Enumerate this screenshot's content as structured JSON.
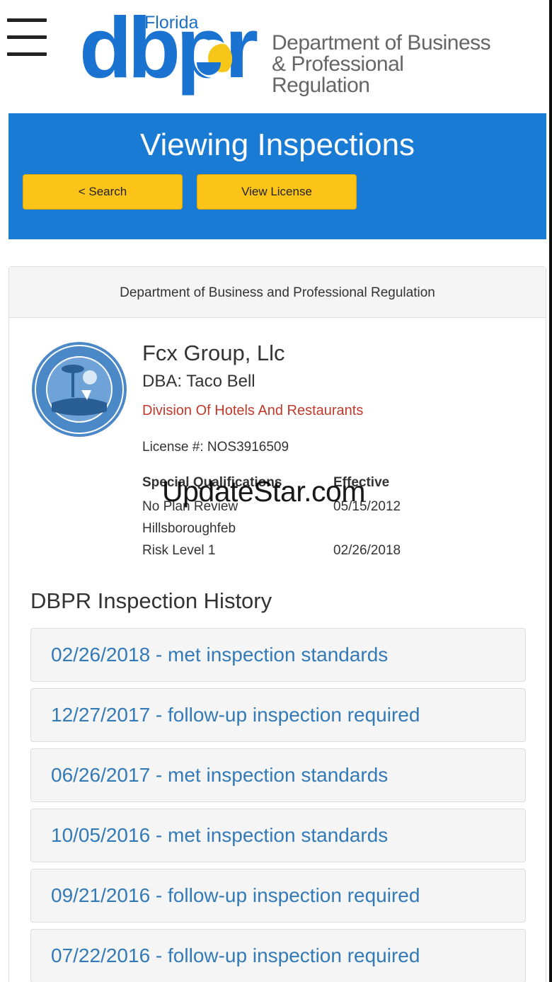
{
  "header": {
    "logo": {
      "florida": "Florida",
      "letters": "dbpr",
      "dept_line1": "Department of Business",
      "dept_line2": "& Professional Regulation"
    },
    "menu_icon": "hamburger-icon"
  },
  "banner": {
    "title": "Viewing Inspections",
    "search_button": "< Search",
    "view_license_button": "View License"
  },
  "panel": {
    "heading": "Department of Business and Professional Regulation",
    "business_name": "Fcx Group, Llc",
    "dba": "DBA: Taco Bell",
    "division": "Division Of Hotels And Restaurants",
    "license": "License #: NOS3916509",
    "qualifications": {
      "headers": [
        "Special Qualifications",
        "Effective"
      ],
      "rows": [
        [
          "No Plan Review",
          "05/15/2012"
        ],
        [
          "Hillsboroughfeb",
          ""
        ],
        [
          "Risk Level 1",
          "02/26/2018"
        ]
      ]
    },
    "seal_icon": "state-seal-icon"
  },
  "watermark": "UpdateStar.com",
  "history": {
    "title": "DBPR Inspection History",
    "items": [
      "02/26/2018 - met inspection standards",
      "12/27/2017 - follow-up inspection required",
      "06/26/2017 - met inspection standards",
      "10/05/2016 - met inspection standards",
      "09/21/2016 - follow-up inspection required",
      "07/22/2016 - follow-up inspection required"
    ]
  },
  "colors": {
    "banner_blue": "#1a7bd5",
    "button_yellow": "#fcc419",
    "link_blue": "#337ab7",
    "division_red": "#c0392b"
  }
}
